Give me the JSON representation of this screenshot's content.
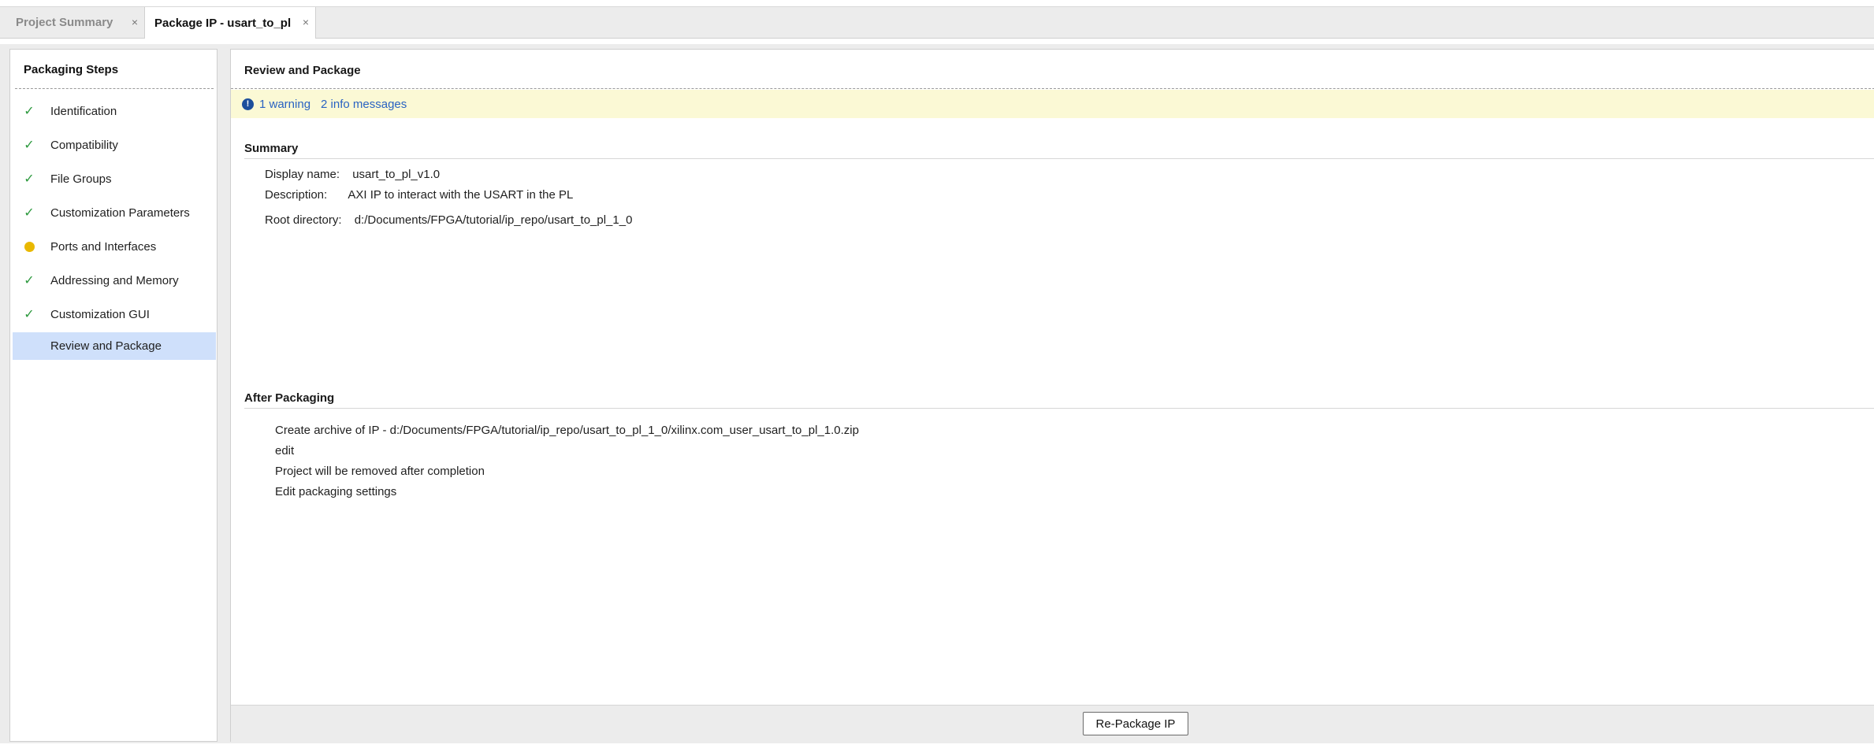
{
  "tabs": [
    {
      "label": "Project Summary",
      "close": "×",
      "active": false
    },
    {
      "label": "Package IP - usart_to_pl",
      "close": "×",
      "active": true
    }
  ],
  "sidebar": {
    "title": "Packaging Steps",
    "items": [
      {
        "label": "Identification",
        "status": "check-icon"
      },
      {
        "label": "Compatibility",
        "status": "check-icon"
      },
      {
        "label": "File Groups",
        "status": "check-icon"
      },
      {
        "label": "Customization Parameters",
        "status": "check-icon"
      },
      {
        "label": "Ports and Interfaces",
        "status": "warning-dot-icon"
      },
      {
        "label": "Addressing and Memory",
        "status": "check-icon"
      },
      {
        "label": "Customization GUI",
        "status": "check-icon"
      },
      {
        "label": "Review and Package",
        "status": "none",
        "selected": true
      }
    ]
  },
  "main": {
    "title": "Review and Package",
    "messages": {
      "icon": "info-icon",
      "warning_link": "1 warning",
      "info_link": "2 info messages"
    },
    "summary": {
      "title": "Summary",
      "rows": [
        {
          "key": "Display name:",
          "value": "usart_to_pl_v1.0"
        },
        {
          "key": "Description:",
          "value": "AXI IP to interact with the USART in the PL"
        },
        {
          "key": "Root directory:",
          "value": "d:/Documents/FPGA/tutorial/ip_repo/usart_to_pl_1_0"
        }
      ]
    },
    "after_packaging": {
      "title": "After Packaging",
      "archive_text": "Create archive of IP - d:/Documents/FPGA/tutorial/ip_repo/usart_to_pl_1_0/xilinx.com_user_usart_to_pl_1.0.zip",
      "edit_link": "edit",
      "removed_text": "Project will be removed after completion",
      "settings_link": "Edit packaging settings"
    },
    "footer": {
      "button_label": "Re-Package IP"
    }
  },
  "colors": {
    "selected_bg": "#cfe0fb",
    "message_bg": "#fbf9d5",
    "check": "#2e9a3f",
    "warning": "#e9b800",
    "link": "#2a63c2"
  }
}
